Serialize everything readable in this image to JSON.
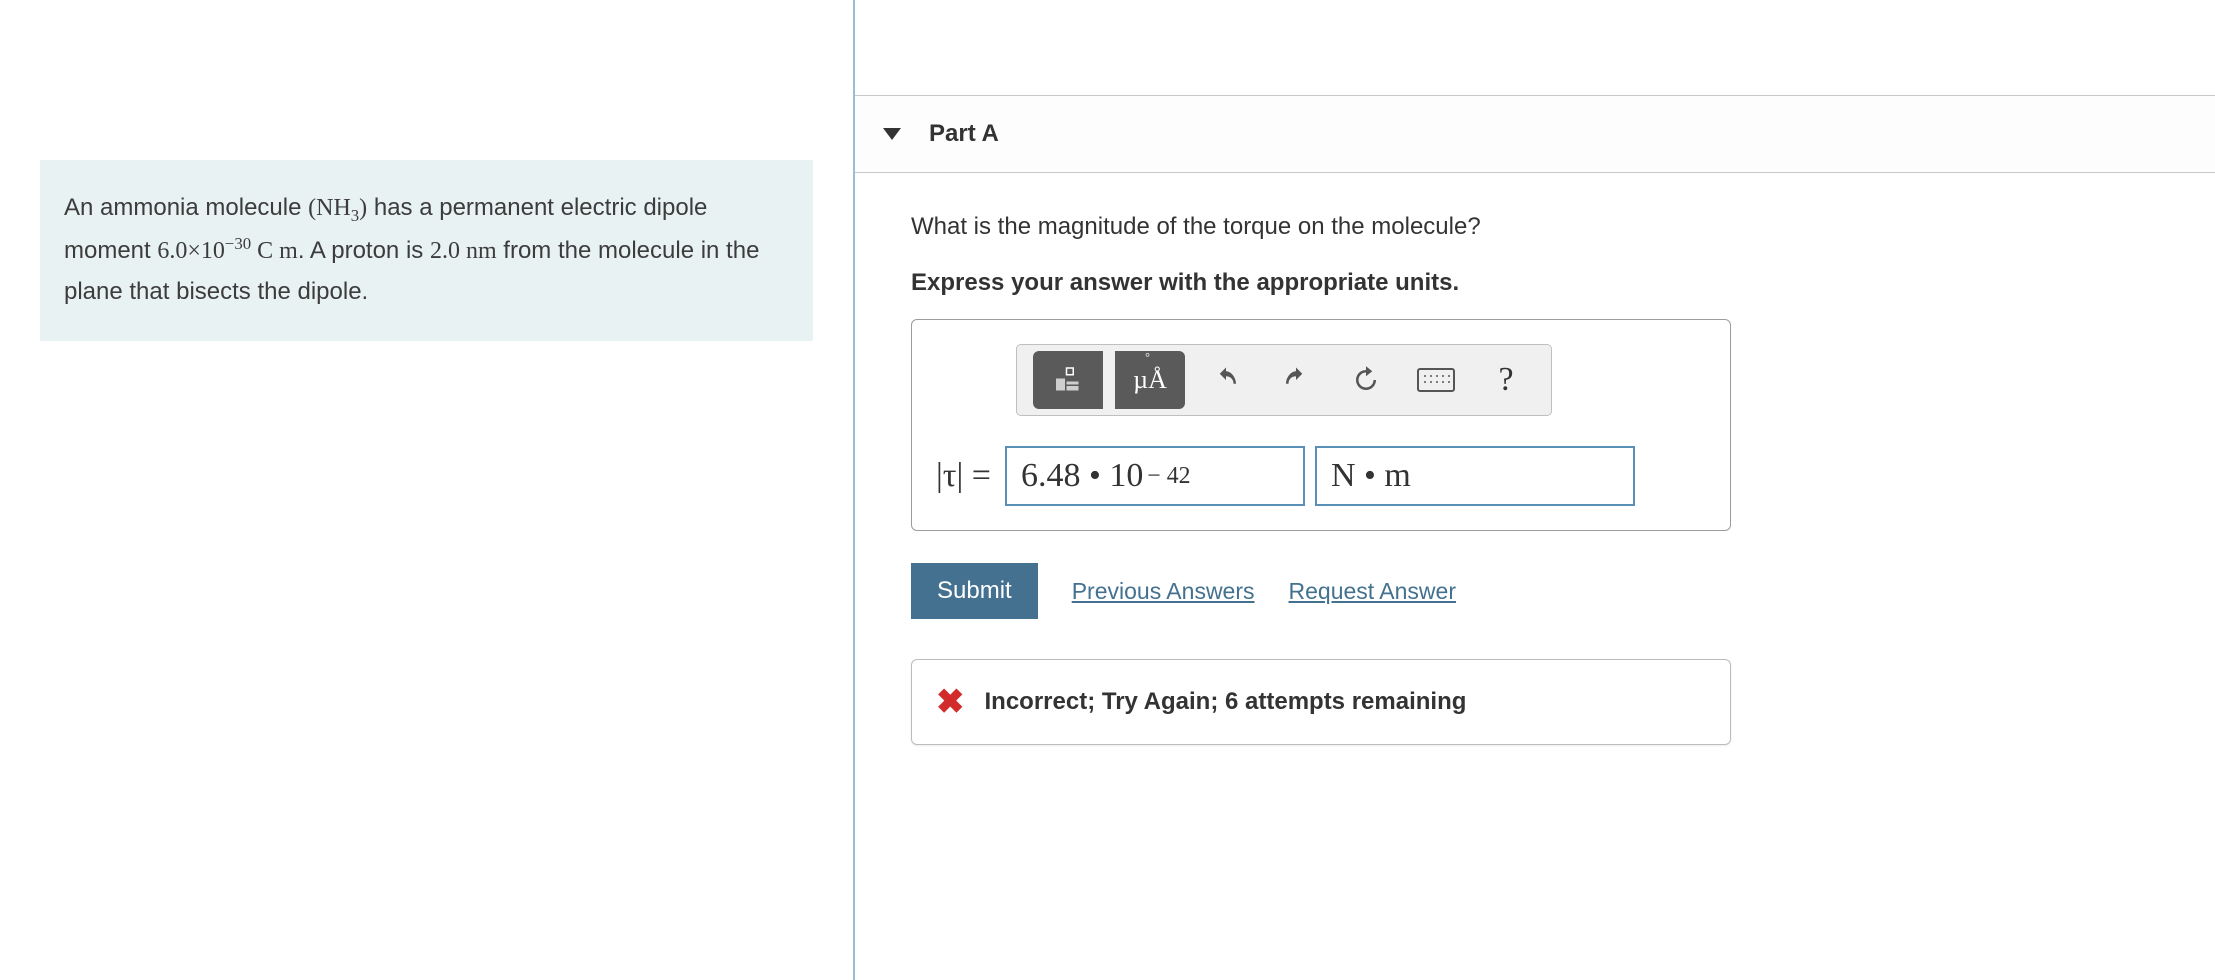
{
  "problem": {
    "text_pre": "An ammonia molecule ",
    "formula_nh3_open": "(NH",
    "formula_nh3_sub": "3",
    "formula_nh3_close": ")",
    "text_mid1": " has a permanent electric dipole moment ",
    "mag": "6.0×10",
    "mag_exp": "−30",
    "unit_dipole": " C m",
    "text_mid2": ". A proton is ",
    "distance": "2.0 nm",
    "text_post": " from the molecule in the plane that bisects the dipole."
  },
  "part": {
    "label": "Part A",
    "question": "What is the magnitude of the torque on the molecule?",
    "instruction": "Express your answer with the appropriate units."
  },
  "toolbar": {
    "units_label": "µÅ",
    "units_ring": "°"
  },
  "answer": {
    "symbol": "|τ| =",
    "value_main": "6.48 • 10",
    "value_exp": "− 42",
    "unit": "N • m"
  },
  "actions": {
    "submit": "Submit",
    "previous": "Previous Answers",
    "request": "Request Answer"
  },
  "feedback": {
    "text": "Incorrect; Try Again; 6 attempts remaining"
  }
}
